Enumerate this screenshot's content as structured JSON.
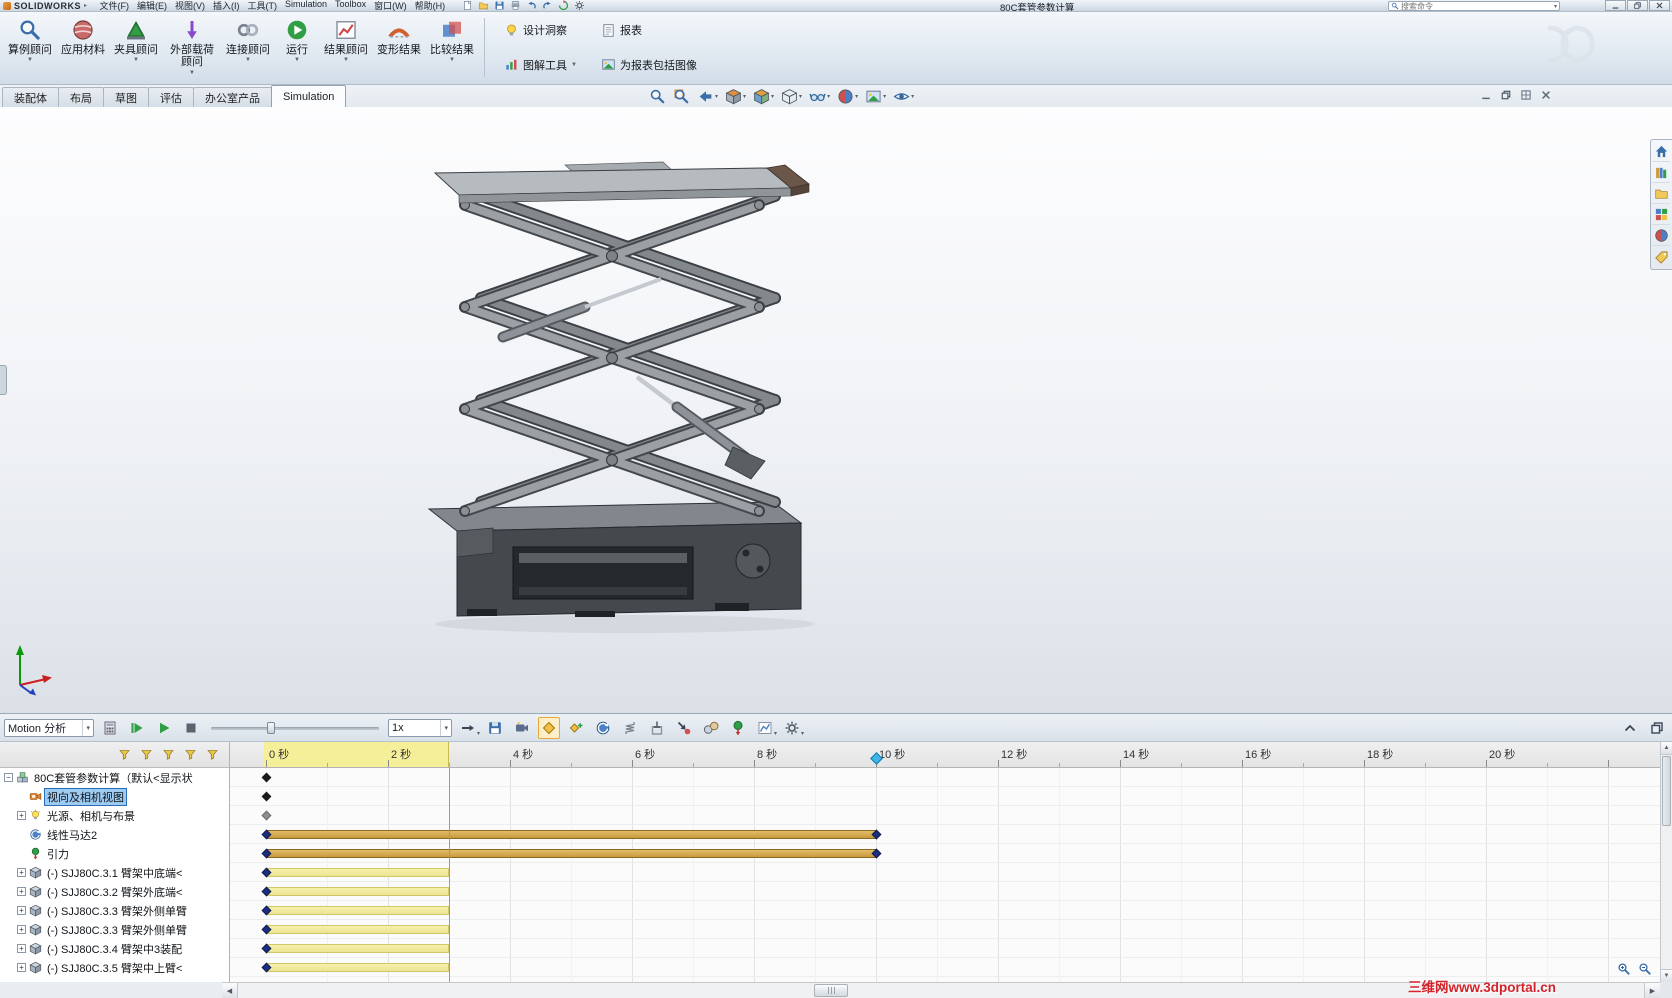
{
  "menubar": {
    "logo": "SOLIDWORKS",
    "menus": [
      "文件(F)",
      "编辑(E)",
      "视图(V)",
      "插入(I)",
      "工具(T)",
      "Simulation",
      "Toolbox",
      "窗口(W)",
      "帮助(H)"
    ],
    "quick_icons": [
      "new-file-icon",
      "open-file-icon",
      "save-icon",
      "print-icon",
      "undo-icon",
      "redo-icon",
      "rebuild-icon",
      "options-icon"
    ],
    "title": "80C套管参数计算",
    "search_placeholder": "搜索命令",
    "window_buttons": [
      "window-minimize-icon",
      "window-restore-icon",
      "window-close-icon"
    ]
  },
  "ribbon": {
    "buttons": [
      {
        "label": "算例顾问",
        "icon": "study-advisor-icon",
        "arrow": true
      },
      {
        "label": "应用材料",
        "icon": "apply-material-icon",
        "arrow": false
      },
      {
        "label": "夹具顾问",
        "icon": "fixtures-advisor-icon",
        "arrow": true
      },
      {
        "label": "外部载荷顾问",
        "icon": "external-loads-icon",
        "arrow": true
      },
      {
        "label": "连接顾问",
        "icon": "connections-advisor-icon",
        "arrow": true
      },
      {
        "label": "运行",
        "icon": "run-icon",
        "arrow": true
      },
      {
        "label": "结果顾问",
        "icon": "results-advisor-icon",
        "arrow": true
      },
      {
        "label": "变形结果",
        "icon": "deformed-result-icon",
        "arrow": false
      },
      {
        "label": "比较结果",
        "icon": "compare-results-icon",
        "arrow": true
      }
    ],
    "small_buttons": [
      {
        "label": "设计洞察",
        "icon": "design-insight-icon",
        "arrow": false
      },
      {
        "label": "图解工具",
        "icon": "plot-tools-icon",
        "arrow": true
      },
      {
        "label": "报表",
        "icon": "report-icon",
        "arrow": false
      },
      {
        "label": "为报表包括图像",
        "icon": "include-image-icon",
        "arrow": false
      }
    ]
  },
  "tabs": {
    "items": [
      "装配体",
      "布局",
      "草图",
      "评估",
      "办公室产品",
      "Simulation"
    ],
    "active": "Simulation"
  },
  "hud": {
    "icons": [
      {
        "name": "zoom-to-fit-icon"
      },
      {
        "name": "zoom-to-area-icon"
      },
      {
        "name": "previous-view-icon",
        "arrow": true
      },
      {
        "name": "section-view-icon",
        "arrow": true
      },
      {
        "name": "view-orientation-icon",
        "arrow": true
      },
      {
        "name": "display-style-icon",
        "arrow": true
      },
      {
        "name": "hide-show-items-icon",
        "arrow": true
      },
      {
        "name": "edit-appearance-icon",
        "arrow": true
      },
      {
        "name": "apply-scene-icon",
        "arrow": true
      },
      {
        "name": "view-settings-icon",
        "arrow": true
      }
    ],
    "window_icons": [
      "doc-minimize-icon",
      "doc-restore-icon",
      "doc-new-window-icon",
      "doc-close-icon"
    ]
  },
  "taskpane": {
    "icons": [
      "resources-home-icon",
      "design-library-icon",
      "file-explorer-icon",
      "view-palette-icon",
      "appearances-scenes-icon",
      "custom-properties-icon"
    ]
  },
  "motion": {
    "toolbar": [
      {
        "kind": "select",
        "name": "study-type-select",
        "value": "Motion 分析"
      },
      {
        "kind": "icon",
        "name": "calculate-icon"
      },
      {
        "kind": "icon",
        "name": "play-from-start-icon"
      },
      {
        "kind": "icon",
        "name": "play-icon"
      },
      {
        "kind": "icon",
        "name": "stop-icon"
      },
      {
        "kind": "slider",
        "name": "timebar-slider"
      },
      {
        "kind": "select",
        "name": "playback-speed-select",
        "value": "1x"
      },
      {
        "kind": "icon",
        "name": "playback-mode-icon",
        "arrow": true
      },
      {
        "kind": "icon",
        "name": "save-animation-icon"
      },
      {
        "kind": "icon",
        "name": "animation-wizard-icon"
      },
      {
        "kind": "icon",
        "name": "auto-key-icon",
        "pressed": true
      },
      {
        "kind": "icon",
        "name": "add-key-icon"
      },
      {
        "kind": "icon",
        "name": "motor-icon"
      },
      {
        "kind": "icon",
        "name": "spring-icon"
      },
      {
        "kind": "icon",
        "name": "damper-icon"
      },
      {
        "kind": "icon",
        "name": "force-icon"
      },
      {
        "kind": "icon",
        "name": "contact-icon"
      },
      {
        "kind": "icon",
        "name": "gravity-icon"
      },
      {
        "kind": "icon",
        "name": "results-plots-icon",
        "arrow": true
      },
      {
        "kind": "icon",
        "name": "motion-properties-icon",
        "arrow": true
      },
      {
        "kind": "spacer"
      },
      {
        "kind": "icon",
        "name": "collapse-motionmanager-icon"
      },
      {
        "kind": "icon",
        "name": "undock-motionmanager-icon"
      }
    ],
    "filters": [
      "filter-no-filter-icon",
      "filter-animated-icon",
      "filter-driving-icon",
      "filter-selected-icon",
      "filter-results-icon"
    ],
    "timeline": {
      "ticks": [
        {
          "t": 0,
          "label": "0 秒"
        },
        {
          "t": 2,
          "label": "2 秒"
        },
        {
          "t": 4,
          "label": "4 秒"
        },
        {
          "t": 6,
          "label": "6 秒"
        },
        {
          "t": 8,
          "label": "8 秒"
        },
        {
          "t": 10,
          "label": "10 秒"
        },
        {
          "t": 12,
          "label": "12 秒"
        },
        {
          "t": 14,
          "label": "14 秒"
        },
        {
          "t": 16,
          "label": "16 秒"
        },
        {
          "t": 18,
          "label": "18 秒"
        },
        {
          "t": 20,
          "label": "20 秒"
        }
      ],
      "computed_range_end_s": 3,
      "current_time_s": 10,
      "zoom_icons": [
        "timeline-zoom-in-icon",
        "timeline-zoom-out-icon"
      ]
    },
    "rows": [
      {
        "label": "80C套管参数计算（默认<显示状",
        "icon": "assembly-icon",
        "expand": "minus",
        "indent": 0,
        "selected": false,
        "keys": [
          {
            "t": 0,
            "color": "black"
          }
        ],
        "bar": null
      },
      {
        "label": "视向及相机视图",
        "icon": "camera-view-icon",
        "expand": "none",
        "indent": 1,
        "selected": true,
        "keys": [
          {
            "t": 0,
            "color": "black"
          }
        ],
        "bar": null
      },
      {
        "label": "光源、相机与布景",
        "icon": "lights-icon",
        "expand": "plus",
        "indent": 1,
        "selected": false,
        "keys": [
          {
            "t": 0,
            "color": "gray"
          }
        ],
        "bar": null
      },
      {
        "label": "线性马达2",
        "icon": "motor-icon",
        "expand": "none",
        "indent": 1,
        "selected": false,
        "keys": [
          {
            "t": 0,
            "color": "navy"
          },
          {
            "t": 10,
            "color": "navy"
          }
        ],
        "bar": {
          "start": 0,
          "end": 10,
          "kind": "motor"
        }
      },
      {
        "label": "引力",
        "icon": "gravity-icon",
        "expand": "none",
        "indent": 1,
        "selected": false,
        "keys": [
          {
            "t": 0,
            "color": "navy"
          },
          {
            "t": 10,
            "color": "navy"
          }
        ],
        "bar": {
          "start": 0,
          "end": 10,
          "kind": "motor"
        }
      },
      {
        "label": "(-) SJJ80C.3.1 臂架中底端<",
        "icon": "component-icon",
        "expand": "plus",
        "indent": 1,
        "selected": false,
        "keys": [
          {
            "t": 0,
            "color": "navy"
          }
        ],
        "bar": {
          "start": 0,
          "end": 3,
          "kind": "component"
        }
      },
      {
        "label": "(-) SJJ80C.3.2 臂架外底端<",
        "icon": "component-icon",
        "expand": "plus",
        "indent": 1,
        "selected": false,
        "keys": [
          {
            "t": 0,
            "color": "navy"
          }
        ],
        "bar": {
          "start": 0,
          "end": 3,
          "kind": "component"
        }
      },
      {
        "label": "(-) SJJ80C.3.3 臂架外侧单臂",
        "icon": "component-icon",
        "expand": "plus",
        "indent": 1,
        "selected": false,
        "keys": [
          {
            "t": 0,
            "color": "navy"
          }
        ],
        "bar": {
          "start": 0,
          "end": 3,
          "kind": "component"
        }
      },
      {
        "label": "(-) SJJ80C.3.3 臂架外侧单臂",
        "icon": "component-icon",
        "expand": "plus",
        "indent": 1,
        "selected": false,
        "keys": [
          {
            "t": 0,
            "color": "navy"
          }
        ],
        "bar": {
          "start": 0,
          "end": 3,
          "kind": "component"
        }
      },
      {
        "label": "(-) SJJ80C.3.4 臂架中3装配",
        "icon": "component-icon",
        "expand": "plus",
        "indent": 1,
        "selected": false,
        "keys": [
          {
            "t": 0,
            "color": "navy"
          }
        ],
        "bar": {
          "start": 0,
          "end": 3,
          "kind": "component"
        }
      },
      {
        "label": "(-) SJJ80C.3.5 臂架中上臂<",
        "icon": "component-icon",
        "expand": "plus",
        "indent": 1,
        "selected": false,
        "keys": [
          {
            "t": 0,
            "color": "navy"
          }
        ],
        "bar": {
          "start": 0,
          "end": 3,
          "kind": "component"
        }
      }
    ]
  },
  "watermark": {
    "text": "三维网www.3dportal.cn"
  }
}
